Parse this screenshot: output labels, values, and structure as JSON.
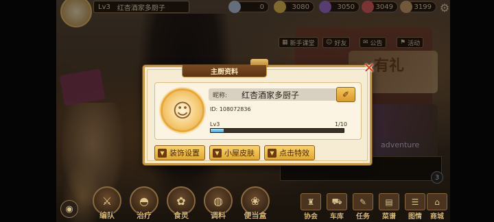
{
  "topbar": {
    "level": "Lv3",
    "player_name": "红杏酒家多厨子",
    "resources": [
      {
        "name": "gem-icon",
        "value": "0",
        "color": "#b8c8e0"
      },
      {
        "name": "coin-icon",
        "value": "3080",
        "color": "#e8c050"
      },
      {
        "name": "crystal-icon",
        "value": "3050",
        "color": "#a070d0"
      },
      {
        "name": "ingredient-icon",
        "value": "3049",
        "color": "#e06060"
      },
      {
        "name": "fish-icon",
        "value": "3199",
        "color": "#d0a070"
      }
    ]
  },
  "side_buttons": {
    "guide": "新手课堂",
    "friends": "好友",
    "notice": "公告",
    "events": "活动"
  },
  "background": {
    "event_text": "adventure",
    "promo_text": "有礼",
    "chat_badge": "3"
  },
  "bottom_nav": [
    {
      "label": "编队",
      "icon": "team-icon"
    },
    {
      "label": "治疗",
      "icon": "cloche-icon"
    },
    {
      "label": "食灵",
      "icon": "spirit-icon"
    },
    {
      "label": "调料",
      "icon": "seasoning-icon"
    },
    {
      "label": "便当盒",
      "icon": "bento-icon"
    }
  ],
  "bottom_right_nav": [
    {
      "label": "协会",
      "icon": "guild-icon"
    },
    {
      "label": "车库",
      "icon": "garage-icon"
    },
    {
      "label": "任务",
      "icon": "task-icon"
    },
    {
      "label": "菜谱",
      "icon": "recipe-icon"
    },
    {
      "label": "图情",
      "icon": "atlas-icon"
    },
    {
      "label": "商城",
      "icon": "shop-icon"
    }
  ],
  "modal": {
    "title": "主厨资料",
    "close": "✕",
    "name_label": "昵称:",
    "name_value": "红杏酒家多厨子",
    "id_text": "ID: 108072836",
    "level_text": "Lv3",
    "xp_text": "1/10",
    "xp_fraction": 0.1,
    "buttons": {
      "decor": "装饰设置",
      "skin": "小屋皮肤",
      "effects": "点击特效"
    }
  }
}
